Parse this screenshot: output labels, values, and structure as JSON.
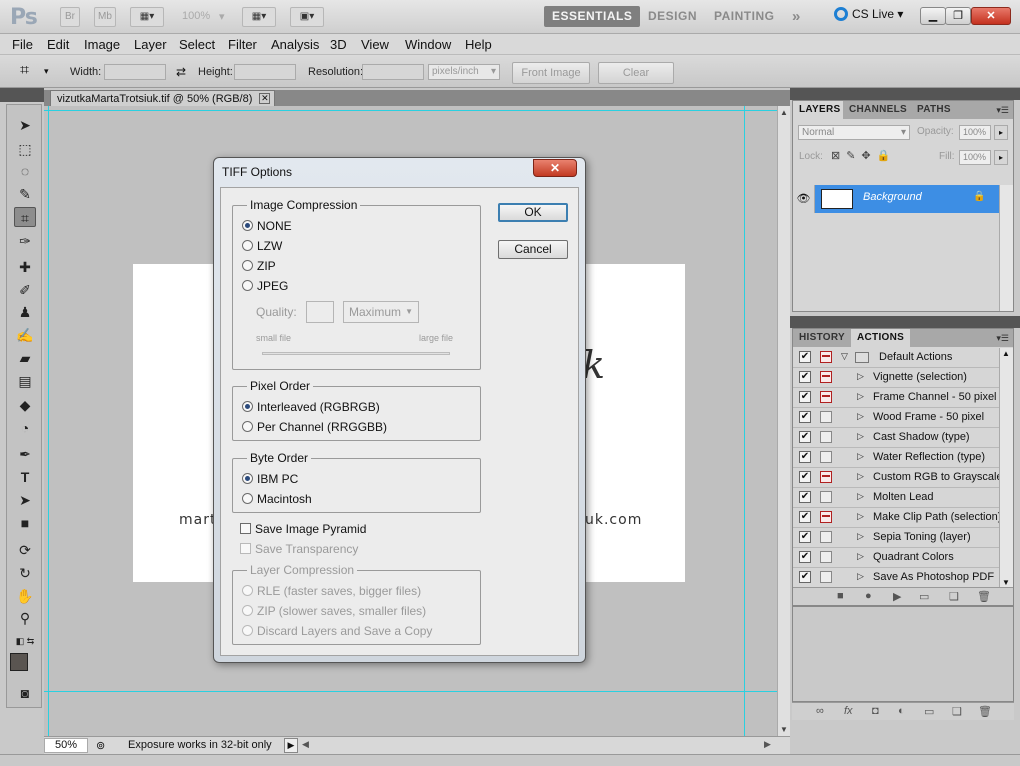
{
  "appbar": {
    "logo": "Ps",
    "br": "Br",
    "mb": "Mb",
    "zoom": "100%",
    "workspaces": [
      {
        "label": "ESSENTIALS",
        "active": true
      },
      {
        "label": "DESIGN",
        "active": false
      },
      {
        "label": "PAINTING",
        "active": false
      }
    ],
    "more": "»",
    "cslive": "CS Live",
    "window_buttons": [
      "minimize",
      "restore",
      "close"
    ]
  },
  "menu": [
    "File",
    "Edit",
    "Image",
    "Layer",
    "Select",
    "Filter",
    "Analysis",
    "3D",
    "View",
    "Window",
    "Help"
  ],
  "options": {
    "width_label": "Width:",
    "width_value": "",
    "height_label": "Height:",
    "height_value": "",
    "resolution_label": "Resolution:",
    "resolution_value": "",
    "resolution_unit": "pixels/inch",
    "front_image": "Front Image",
    "clear": "Clear"
  },
  "document": {
    "tab_title": "vizutkaMartaTrotsiuk.tif @ 50% (RGB/8)",
    "card_left_text": "mart",
    "card_right_text": "uk.com",
    "card_glyph": "k"
  },
  "status": {
    "zoom": "50%",
    "message": "Exposure works in 32-bit only"
  },
  "layers_panel": {
    "tabs": [
      "LAYERS",
      "CHANNELS",
      "PATHS"
    ],
    "blend_mode": "Normal",
    "opacity_label": "Opacity:",
    "opacity_value": "100%",
    "lock_label": "Lock:",
    "fill_label": "Fill:",
    "fill_value": "100%",
    "layer_name": "Background"
  },
  "actions_panel": {
    "tabs": [
      "HISTORY",
      "ACTIONS"
    ],
    "set_name": "Default Actions",
    "actions": [
      {
        "name": "Vignette (selection)",
        "dialog": true
      },
      {
        "name": "Frame Channel - 50 pixel",
        "dialog": true
      },
      {
        "name": "Wood Frame - 50 pixel",
        "dialog": false
      },
      {
        "name": "Cast Shadow (type)",
        "dialog": false
      },
      {
        "name": "Water Reflection (type)",
        "dialog": false
      },
      {
        "name": "Custom RGB to Grayscale",
        "dialog": true
      },
      {
        "name": "Molten Lead",
        "dialog": false
      },
      {
        "name": "Make Clip Path (selection)",
        "dialog": true
      },
      {
        "name": "Sepia Toning (layer)",
        "dialog": false
      },
      {
        "name": "Quadrant Colors",
        "dialog": false
      },
      {
        "name": "Save As Photoshop PDF",
        "dialog": false
      }
    ]
  },
  "dialog": {
    "title": "TIFF Options",
    "ok": "OK",
    "cancel": "Cancel",
    "compression": {
      "title": "Image Compression",
      "options": [
        "NONE",
        "LZW",
        "ZIP",
        "JPEG"
      ],
      "selected": "NONE",
      "quality_label": "Quality:",
      "quality_select": "Maximum",
      "small_file": "small file",
      "large_file": "large file"
    },
    "pixel_order": {
      "title": "Pixel Order",
      "options": [
        "Interleaved (RGBRGB)",
        "Per Channel (RRGGBB)"
      ],
      "selected": "Interleaved (RGBRGB)"
    },
    "byte_order": {
      "title": "Byte Order",
      "options": [
        "IBM PC",
        "Macintosh"
      ],
      "selected": "IBM PC"
    },
    "save_pyramid": "Save Image Pyramid",
    "save_transparency": "Save Transparency",
    "layer_compression": {
      "title": "Layer Compression",
      "options": [
        "RLE (faster saves, bigger files)",
        "ZIP (slower saves, smaller files)",
        "Discard Layers and Save a Copy"
      ]
    }
  }
}
